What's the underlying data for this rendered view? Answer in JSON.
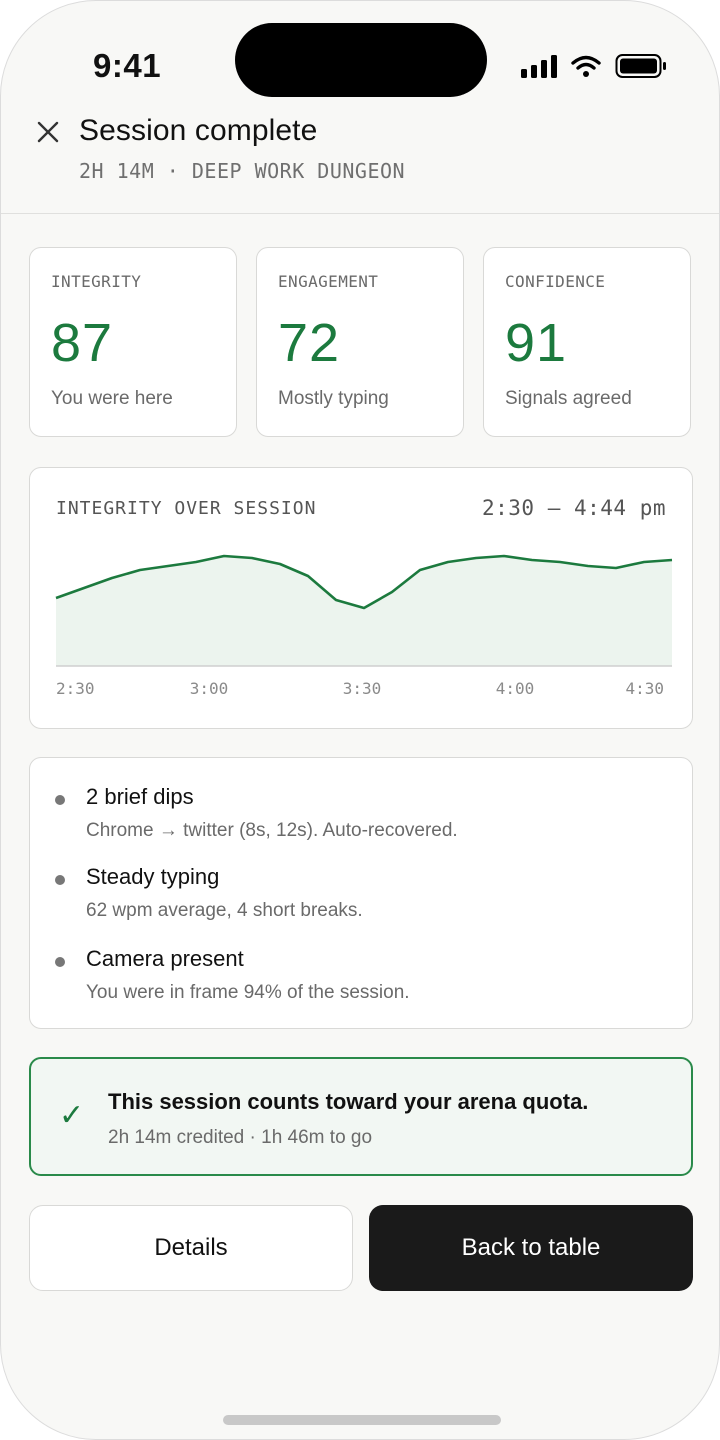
{
  "status_bar": {
    "time": "9:41",
    "icons": [
      "signal-icon",
      "wifi-icon",
      "battery-icon"
    ]
  },
  "header": {
    "title": "Session complete",
    "subtitle": "2H 14M · DEEP WORK DUNGEON",
    "close_icon": "close-icon"
  },
  "stats": [
    {
      "label": "INTEGRITY",
      "value": "87",
      "note": "You were here"
    },
    {
      "label": "ENGAGEMENT",
      "value": "72",
      "note": "Mostly typing"
    },
    {
      "label": "CONFIDENCE",
      "value": "91",
      "note": "Signals agreed"
    }
  ],
  "chart": {
    "title": "INTEGRITY OVER SESSION",
    "range": "2:30 – 4:44 pm"
  },
  "chart_data": {
    "type": "area",
    "title": "INTEGRITY OVER SESSION",
    "x_tick_labels": [
      "2:30",
      "3:00",
      "3:30",
      "4:00",
      "4:30"
    ],
    "x_minutes": [
      0,
      12,
      24,
      36,
      48,
      60,
      72,
      84,
      96,
      108,
      120,
      132,
      144,
      156,
      168,
      180,
      192,
      204,
      216,
      228,
      240,
      252,
      264
    ],
    "values": [
      77,
      79.5,
      82,
      84,
      85,
      86,
      87.5,
      87,
      85.5,
      82.5,
      76.5,
      74.5,
      78.5,
      84,
      86,
      87,
      87.5,
      86.5,
      86,
      85,
      84.5,
      86,
      86.5
    ],
    "ylim": [
      60,
      92
    ],
    "grid": false,
    "colors": {
      "line": "#1c7a3e",
      "fill": "#ecf4ee",
      "baseline": "#cfcfcf"
    }
  },
  "notes": [
    {
      "title": "2 brief dips",
      "detail": "Chrome → twitter (8s, 12s). Auto-recovered."
    },
    {
      "title": "Steady typing",
      "detail": "62 wpm average, 4 short breaks."
    },
    {
      "title": "Camera present",
      "detail": "You were in frame 94% of the session."
    }
  ],
  "quota": {
    "icon": "checkmark-icon",
    "title": "This session counts toward your arena quota.",
    "subtitle": "2h 14m credited · 1h 46m to go"
  },
  "actions": {
    "details_label": "Details",
    "back_label": "Back to table"
  },
  "colors": {
    "accent_green": "#1c7a3e",
    "primary_button": "#1a1a1a",
    "background": "#f8f8f6"
  }
}
